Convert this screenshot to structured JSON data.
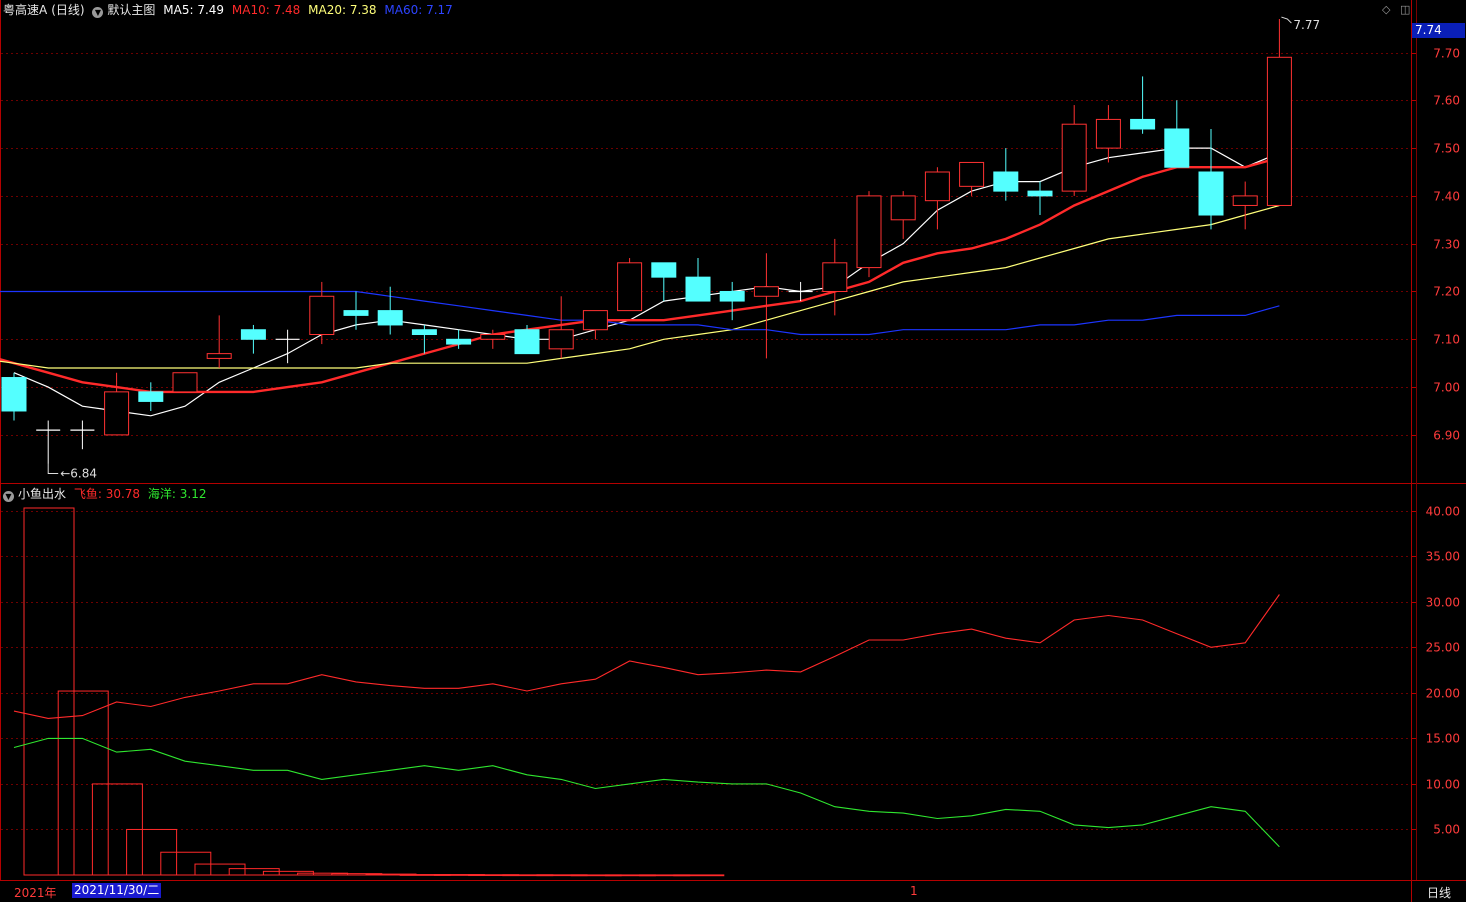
{
  "main_header": {
    "stock_name": "粤高速A",
    "period": "(日线)",
    "template": "默认主图",
    "ma5": "MA5: 7.49",
    "ma10": "MA10: 7.48",
    "ma20": "MA20: 7.38",
    "ma60": "MA60: 7.17"
  },
  "sub_header": {
    "indicator": "小鱼出水",
    "feiyu": "飞鱼: 30.78",
    "haiyang": "海洋: 3.12"
  },
  "current_price": "7.74",
  "bottom": {
    "year": "2021年",
    "date": "2021/11/30/二",
    "marker": "1",
    "period_button": "日线"
  },
  "colors": {
    "up": "#ff3232",
    "down": "#54ffff",
    "ma5": "#ffffff",
    "ma10": "#ff2a2a",
    "ma20": "#ffff7a",
    "ma60": "#1c35ff",
    "feiyu": "#ff2a2a",
    "haiyang": "#2fe62f",
    "grid": "#6e0000",
    "axis": "#b40000"
  },
  "chart_data": [
    {
      "type": "candlestick",
      "title": "粤高速A (日线)",
      "ylim": [
        6.8,
        7.8
      ],
      "yticks": [
        6.9,
        7.0,
        7.1,
        7.2,
        7.3,
        7.4,
        7.5,
        7.6,
        7.7
      ],
      "annotations": [
        {
          "label": "6.84",
          "value": 6.84,
          "type": "low"
        },
        {
          "label": "7.77",
          "value": 7.77,
          "type": "high"
        }
      ],
      "candles": [
        {
          "o": 7.02,
          "h": 7.03,
          "l": 6.93,
          "c": 6.95
        },
        {
          "o": 6.91,
          "h": 6.93,
          "l": 6.84,
          "c": 6.91
        },
        {
          "o": 6.91,
          "h": 6.93,
          "l": 6.87,
          "c": 6.91
        },
        {
          "o": 6.9,
          "h": 7.03,
          "l": 6.9,
          "c": 6.99
        },
        {
          "o": 6.99,
          "h": 7.01,
          "l": 6.95,
          "c": 6.97
        },
        {
          "o": 6.99,
          "h": 7.03,
          "l": 6.99,
          "c": 7.03
        },
        {
          "o": 7.06,
          "h": 7.15,
          "l": 7.04,
          "c": 7.07
        },
        {
          "o": 7.12,
          "h": 7.13,
          "l": 7.07,
          "c": 7.1
        },
        {
          "o": 7.1,
          "h": 7.12,
          "l": 7.05,
          "c": 7.1
        },
        {
          "o": 7.11,
          "h": 7.22,
          "l": 7.09,
          "c": 7.19
        },
        {
          "o": 7.16,
          "h": 7.2,
          "l": 7.12,
          "c": 7.15
        },
        {
          "o": 7.16,
          "h": 7.21,
          "l": 7.11,
          "c": 7.13
        },
        {
          "o": 7.12,
          "h": 7.13,
          "l": 7.07,
          "c": 7.11
        },
        {
          "o": 7.1,
          "h": 7.12,
          "l": 7.08,
          "c": 7.09
        },
        {
          "o": 7.1,
          "h": 7.12,
          "l": 7.08,
          "c": 7.11
        },
        {
          "o": 7.12,
          "h": 7.13,
          "l": 7.07,
          "c": 7.07
        },
        {
          "o": 7.08,
          "h": 7.19,
          "l": 7.06,
          "c": 7.12
        },
        {
          "o": 7.12,
          "h": 7.16,
          "l": 7.1,
          "c": 7.16
        },
        {
          "o": 7.16,
          "h": 7.27,
          "l": 7.16,
          "c": 7.26
        },
        {
          "o": 7.26,
          "h": 7.26,
          "l": 7.18,
          "c": 7.23
        },
        {
          "o": 7.23,
          "h": 7.27,
          "l": 7.18,
          "c": 7.18
        },
        {
          "o": 7.2,
          "h": 7.22,
          "l": 7.14,
          "c": 7.18
        },
        {
          "o": 7.19,
          "h": 7.28,
          "l": 7.06,
          "c": 7.21
        },
        {
          "o": 7.2,
          "h": 7.22,
          "l": 7.18,
          "c": 7.2
        },
        {
          "o": 7.2,
          "h": 7.31,
          "l": 7.15,
          "c": 7.26
        },
        {
          "o": 7.25,
          "h": 7.41,
          "l": 7.23,
          "c": 7.4
        },
        {
          "o": 7.35,
          "h": 7.41,
          "l": 7.31,
          "c": 7.4
        },
        {
          "o": 7.39,
          "h": 7.46,
          "l": 7.33,
          "c": 7.45
        },
        {
          "o": 7.42,
          "h": 7.47,
          "l": 7.4,
          "c": 7.47
        },
        {
          "o": 7.45,
          "h": 7.5,
          "l": 7.39,
          "c": 7.41
        },
        {
          "o": 7.41,
          "h": 7.43,
          "l": 7.36,
          "c": 7.4
        },
        {
          "o": 7.41,
          "h": 7.59,
          "l": 7.4,
          "c": 7.55
        },
        {
          "o": 7.5,
          "h": 7.59,
          "l": 7.47,
          "c": 7.56
        },
        {
          "o": 7.56,
          "h": 7.65,
          "l": 7.53,
          "c": 7.54
        },
        {
          "o": 7.54,
          "h": 7.6,
          "l": 7.47,
          "c": 7.46
        },
        {
          "o": 7.45,
          "h": 7.54,
          "l": 7.33,
          "c": 7.36
        },
        {
          "o": 7.38,
          "h": 7.43,
          "l": 7.33,
          "c": 7.4
        },
        {
          "o": 7.38,
          "h": 7.77,
          "l": 7.38,
          "c": 7.69
        }
      ],
      "series": [
        {
          "name": "MA5",
          "color": "#ffffff",
          "values": [
            7.03,
            7.0,
            6.96,
            6.95,
            6.94,
            6.96,
            7.01,
            7.04,
            7.07,
            7.11,
            7.13,
            7.14,
            7.13,
            7.12,
            7.11,
            7.1,
            7.1,
            7.12,
            7.14,
            7.18,
            7.19,
            7.2,
            7.21,
            7.2,
            7.21,
            7.26,
            7.3,
            7.37,
            7.41,
            7.43,
            7.43,
            7.46,
            7.48,
            7.49,
            7.5,
            7.5,
            7.46,
            7.49
          ]
        },
        {
          "name": "MA10",
          "color": "#ff2a2a",
          "values": [
            7.07,
            7.05,
            7.03,
            7.01,
            7.0,
            6.99,
            6.99,
            6.99,
            6.99,
            7.0,
            7.01,
            7.03,
            7.05,
            7.07,
            7.09,
            7.11,
            7.12,
            7.13,
            7.14,
            7.14,
            7.14,
            7.15,
            7.16,
            7.17,
            7.18,
            7.2,
            7.22,
            7.26,
            7.28,
            7.29,
            7.31,
            7.34,
            7.38,
            7.41,
            7.44,
            7.46,
            7.46,
            7.46,
            7.48
          ]
        },
        {
          "name": "MA20",
          "color": "#ffff7a",
          "values": [
            7.06,
            7.05,
            7.04,
            7.04,
            7.04,
            7.04,
            7.04,
            7.04,
            7.04,
            7.04,
            7.04,
            7.04,
            7.05,
            7.05,
            7.05,
            7.05,
            7.05,
            7.06,
            7.07,
            7.08,
            7.1,
            7.11,
            7.12,
            7.14,
            7.16,
            7.18,
            7.2,
            7.22,
            7.23,
            7.24,
            7.25,
            7.27,
            7.29,
            7.31,
            7.32,
            7.33,
            7.34,
            7.36,
            7.38
          ]
        },
        {
          "name": "MA60",
          "color": "#1c35ff",
          "values": [
            7.2,
            7.2,
            7.2,
            7.2,
            7.2,
            7.2,
            7.2,
            7.2,
            7.2,
            7.2,
            7.2,
            7.2,
            7.19,
            7.18,
            7.17,
            7.16,
            7.15,
            7.14,
            7.14,
            7.13,
            7.13,
            7.13,
            7.12,
            7.12,
            7.11,
            7.11,
            7.11,
            7.12,
            7.12,
            7.12,
            7.12,
            7.13,
            7.13,
            7.14,
            7.14,
            7.15,
            7.15,
            7.15,
            7.17
          ]
        }
      ]
    },
    {
      "type": "line",
      "title": "小鱼出水",
      "ylim": [
        0,
        42
      ],
      "yticks": [
        5.0,
        10.0,
        15.0,
        20.0,
        25.0,
        30.0,
        35.0,
        40.0
      ],
      "series": [
        {
          "name": "飞鱼",
          "color": "#ff2a2a",
          "values": [
            18.0,
            17.2,
            17.5,
            19.0,
            18.5,
            19.5,
            20.2,
            21.0,
            21.0,
            22.0,
            21.2,
            20.8,
            20.5,
            20.5,
            21.0,
            20.2,
            21.0,
            21.5,
            23.5,
            22.8,
            22.0,
            22.2,
            22.5,
            22.3,
            24.0,
            25.8,
            25.8,
            26.5,
            27.0,
            26.0,
            25.5,
            28.0,
            28.5,
            28.0,
            26.5,
            25.0,
            25.5,
            30.8
          ]
        },
        {
          "name": "海洋",
          "color": "#2fe62f",
          "values": [
            14.0,
            15.0,
            15.0,
            13.5,
            13.8,
            12.5,
            12.0,
            11.5,
            11.5,
            10.5,
            11.0,
            11.5,
            12.0,
            11.5,
            12.0,
            11.0,
            10.5,
            9.5,
            10.0,
            10.5,
            10.2,
            10.0,
            10.0,
            9.0,
            7.5,
            7.0,
            6.8,
            6.2,
            6.5,
            7.2,
            7.0,
            5.5,
            5.2,
            5.5,
            6.5,
            7.5,
            7.0,
            3.1
          ]
        }
      ],
      "bars": [
        40.3,
        20.2,
        10.0,
        5.0,
        2.5,
        1.2,
        0.7,
        0.4,
        0.2,
        0.15,
        0.1,
        0.05,
        0.05,
        0.03,
        0.02,
        0.02,
        0.01,
        0.01,
        0.01,
        0.01
      ]
    }
  ]
}
